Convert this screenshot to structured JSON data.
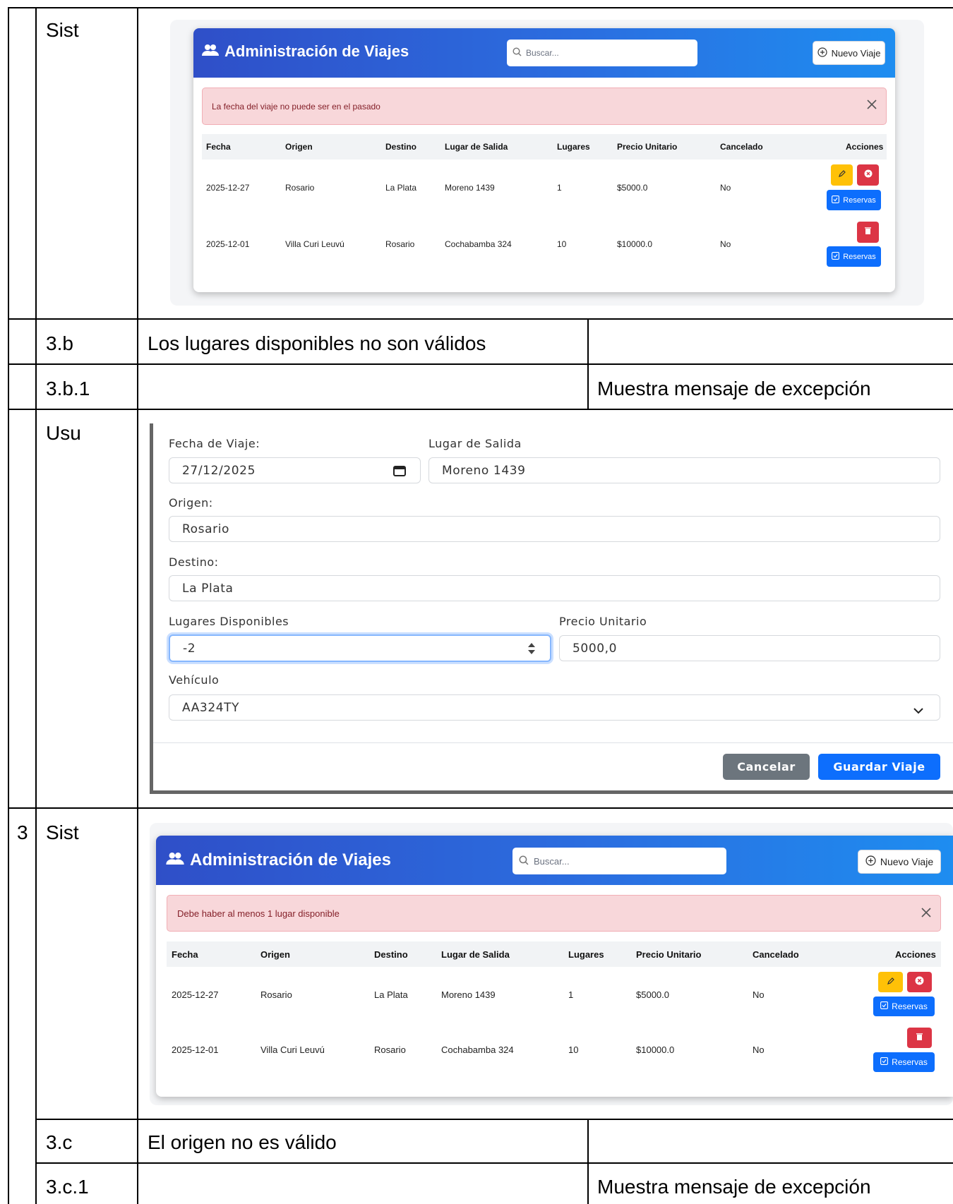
{
  "rows": {
    "r1": {
      "actor": "Sist"
    },
    "r2": {
      "step": "3.b",
      "description": "Los lugares disponibles no son válidos"
    },
    "r3": {
      "step": "3.b.1",
      "response": "Muestra mensaje de excepción"
    },
    "r4": {
      "actor": "Usu"
    },
    "r5": {
      "num": "3",
      "actor": "Sist"
    },
    "r6": {
      "step": "3.c",
      "description": "El origen no es válido"
    },
    "r7": {
      "step": "3.c.1",
      "response": "Muestra mensaje de excepción"
    }
  },
  "app": {
    "title": "Administración de Viajes",
    "search_placeholder": "Buscar...",
    "new_button": "Nuevo Viaje",
    "columns": [
      "Fecha",
      "Origen",
      "Destino",
      "Lugar de Salida",
      "Lugares",
      "Precio Unitario",
      "Cancelado",
      "Acciones"
    ],
    "reservas_label": "Reservas",
    "trips": [
      {
        "fecha": "2025-12-27",
        "origen": "Rosario",
        "destino": "La Plata",
        "salida": "Moreno 1439",
        "lugares": "1",
        "precio": "$5000.0",
        "cancelado": "No"
      },
      {
        "fecha": "2025-12-01",
        "origen": "Villa Curi Leuvú",
        "destino": "Rosario",
        "salida": "Cochabamba 324",
        "lugares": "10",
        "precio": "$10000.0",
        "cancelado": "No"
      }
    ],
    "alert_first": "La fecha del viaje no puede ser en el pasado",
    "alert_second": "Debe haber al menos 1 lugar disponible",
    "colors": {
      "edit": "#ffc107",
      "cancel": "#dc3545",
      "delete": "#dc3545",
      "primary": "#0d6efd"
    }
  },
  "form": {
    "fecha_label": "Fecha de Viaje:",
    "fecha_value": "27/12/2025",
    "salida_label": "Lugar de Salida",
    "salida_value": "Moreno 1439",
    "origen_label": "Origen:",
    "origen_value": "Rosario",
    "destino_label": "Destino:",
    "destino_value": "La Plata",
    "lugares_label": "Lugares Disponibles",
    "lugares_value": "-2",
    "precio_label": "Precio Unitario",
    "precio_value": "5000,0",
    "vehiculo_label": "Vehículo",
    "vehiculo_value": "AA324TY",
    "cancel_button": "Cancelar",
    "save_button": "Guardar Viaje"
  }
}
